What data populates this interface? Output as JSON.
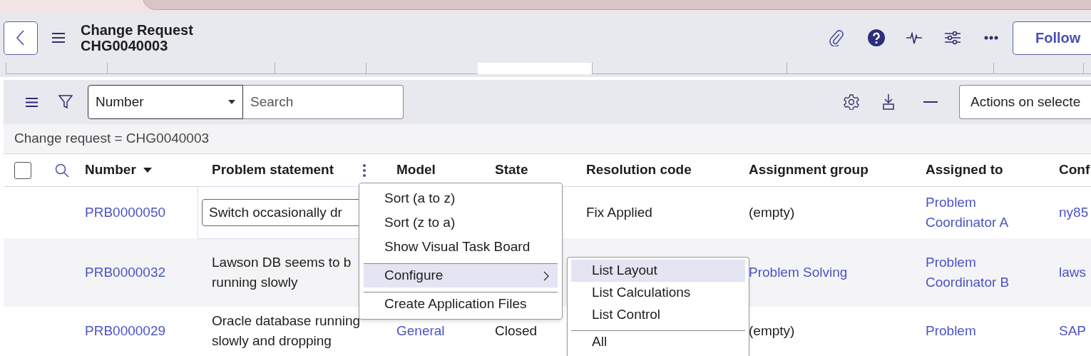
{
  "header": {
    "title": "Change Request",
    "record_number": "CHG0040003",
    "follow_button": "Follow"
  },
  "list_toolbar": {
    "field_select": "Number",
    "search_placeholder": "Search",
    "actions_select": "Actions on selecte"
  },
  "breadcrumb": "Change request = CHG0040003",
  "table": {
    "select_all": {
      "checked": false
    },
    "columns": [
      {
        "label": "Number",
        "sorted": true
      },
      {
        "label": "Problem statement",
        "has_menu": true
      },
      {
        "label": "Model"
      },
      {
        "label": "State"
      },
      {
        "label": "Resolution code"
      },
      {
        "label": "Assignment group"
      },
      {
        "label": "Assigned to"
      },
      {
        "label": "Conf"
      }
    ],
    "rows": [
      {
        "cells": [
          {
            "kind": "link",
            "lines": [
              "PRB0000050"
            ]
          },
          {
            "kind": "editing",
            "lines": [
              "Switch occasionally dr"
            ]
          },
          {
            "kind": "empty"
          },
          {
            "kind": "empty"
          },
          {
            "kind": "text",
            "lines": [
              "Fix Applied"
            ]
          },
          {
            "kind": "text",
            "lines": [
              "(empty)"
            ]
          },
          {
            "kind": "link",
            "lines": [
              "Problem",
              "Coordinator A"
            ]
          },
          {
            "kind": "link",
            "lines": [
              "ny85"
            ]
          }
        ]
      },
      {
        "cells": [
          {
            "kind": "link",
            "lines": [
              "PRB0000032"
            ]
          },
          {
            "kind": "text",
            "lines": [
              "Lawson DB seems to b",
              "running slowly"
            ]
          },
          {
            "kind": "empty"
          },
          {
            "kind": "empty"
          },
          {
            "kind": "empty"
          },
          {
            "kind": "link",
            "lines": [
              "Problem Solving"
            ]
          },
          {
            "kind": "link",
            "lines": [
              "Problem",
              "Coordinator B"
            ]
          },
          {
            "kind": "link",
            "lines": [
              "laws"
            ]
          }
        ]
      },
      {
        "cells": [
          {
            "kind": "link",
            "lines": [
              "PRB0000029"
            ]
          },
          {
            "kind": "text",
            "lines": [
              "Oracle database running",
              "slowly and dropping"
            ]
          },
          {
            "kind": "link",
            "lines": [
              "General"
            ]
          },
          {
            "kind": "text",
            "lines": [
              "Closed"
            ]
          },
          {
            "kind": "empty"
          },
          {
            "kind": "text",
            "lines": [
              "(empty)"
            ]
          },
          {
            "kind": "link",
            "lines": [
              "Problem"
            ]
          },
          {
            "kind": "link",
            "lines": [
              "SAP"
            ]
          }
        ]
      }
    ]
  },
  "column_menu": {
    "items": [
      {
        "label": "Sort (a to z)",
        "selected": false,
        "divider_before": false,
        "has_submenu": false
      },
      {
        "label": "Sort (z to a)",
        "selected": false,
        "divider_before": false,
        "has_submenu": false
      },
      {
        "label": "Show Visual Task Board",
        "selected": false,
        "divider_before": false,
        "has_submenu": false
      },
      {
        "label": "Configure",
        "selected": true,
        "divider_before": true,
        "has_submenu": true
      },
      {
        "label": "Create Application Files",
        "selected": false,
        "divider_before": true,
        "has_submenu": false
      }
    ]
  },
  "submenu": {
    "items": [
      {
        "label": "List Layout",
        "selected": true,
        "divider_before": false
      },
      {
        "label": "List Calculations",
        "selected": false,
        "divider_before": false
      },
      {
        "label": "List Control",
        "selected": false,
        "divider_before": false
      },
      {
        "label": "All",
        "selected": false,
        "divider_before": true
      }
    ]
  }
}
